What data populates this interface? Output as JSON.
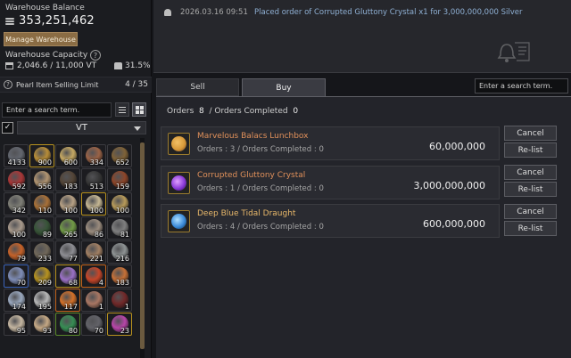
{
  "warehouse": {
    "balance_label": "Warehouse Balance",
    "balance_value": "353,251,462",
    "manage_label": "Manage Warehouse",
    "capacity_label": "Warehouse Capacity",
    "capacity_value": "2,046.6 / 11,000 VT",
    "weight_percent": "31.5%"
  },
  "pearl": {
    "label": "Pearl Item Selling Limit",
    "value": "4 / 35"
  },
  "left_search": {
    "placeholder": "Enter a search term."
  },
  "filter": {
    "checked": "✓",
    "selected": "VT"
  },
  "inventory": [
    {
      "count": "4133",
      "color": "#6b6f78",
      "tier": ""
    },
    {
      "count": "900",
      "color": "#c99a3a",
      "tier": "gold"
    },
    {
      "count": "600",
      "color": "#d8b86a",
      "tier": ""
    },
    {
      "count": "334",
      "color": "#a86a4a",
      "tier": ""
    },
    {
      "count": "652",
      "color": "#8a6a3a",
      "tier": ""
    },
    {
      "count": "592",
      "color": "#b83a3a",
      "tier": ""
    },
    {
      "count": "556",
      "color": "#c2a27a",
      "tier": ""
    },
    {
      "count": "183",
      "color": "#5a4a3a",
      "tier": ""
    },
    {
      "count": "513",
      "color": "#3a3a3a",
      "tier": ""
    },
    {
      "count": "159",
      "color": "#9a4a2a",
      "tier": ""
    },
    {
      "count": "342",
      "color": "#8a8a80",
      "tier": ""
    },
    {
      "count": "110",
      "color": "#b87a3a",
      "tier": ""
    },
    {
      "count": "100",
      "color": "#c8b090",
      "tier": ""
    },
    {
      "count": "100",
      "color": "#d8c8a0",
      "tier": "gold"
    },
    {
      "count": "100",
      "color": "#c8a860",
      "tier": ""
    },
    {
      "count": "100",
      "color": "#b8a898",
      "tier": ""
    },
    {
      "count": "89",
      "color": "#3a5a3a",
      "tier": ""
    },
    {
      "count": "265",
      "color": "#7aa84a",
      "tier": ""
    },
    {
      "count": "86",
      "color": "#a89888",
      "tier": ""
    },
    {
      "count": "81",
      "color": "#8a8a8a",
      "tier": ""
    },
    {
      "count": "79",
      "color": "#d86a2a",
      "tier": ""
    },
    {
      "count": "233",
      "color": "#7a7060",
      "tier": ""
    },
    {
      "count": "77",
      "color": "#9a9aa0",
      "tier": ""
    },
    {
      "count": "221",
      "color": "#b08a6a",
      "tier": ""
    },
    {
      "count": "216",
      "color": "#9aa0a0",
      "tier": ""
    },
    {
      "count": "70",
      "color": "#8a9ac8",
      "tier": "blue"
    },
    {
      "count": "209",
      "color": "#c8a020",
      "tier": ""
    },
    {
      "count": "68",
      "color": "#a87ad8",
      "tier": "gold"
    },
    {
      "count": "4",
      "color": "#d84a2a",
      "tier": "orange"
    },
    {
      "count": "183",
      "color": "#d87a3a",
      "tier": ""
    },
    {
      "count": "174",
      "color": "#a8b8d0",
      "tier": ""
    },
    {
      "count": "195",
      "color": "#c8c8c8",
      "tier": ""
    },
    {
      "count": "117",
      "color": "#e87a2a",
      "tier": "orange"
    },
    {
      "count": "1",
      "color": "#b8806a",
      "tier": ""
    },
    {
      "count": "1",
      "color": "#7a2a2a",
      "tier": ""
    },
    {
      "count": "95",
      "color": "#d8c8b0",
      "tier": ""
    },
    {
      "count": "93",
      "color": "#d8b890",
      "tier": ""
    },
    {
      "count": "80",
      "color": "#3a9a5a",
      "tier": "green"
    },
    {
      "count": "70",
      "color": "#6a6a70",
      "tier": ""
    },
    {
      "count": "23",
      "color": "#c84ab8",
      "tier": "gold"
    }
  ],
  "notification": {
    "time": "2026.03.16 09:51",
    "message": "Placed order of Corrupted Gluttony Crystal x1 for 3,000,000,000 Silver"
  },
  "tabs": {
    "sell": "Sell",
    "buy": "Buy"
  },
  "right_search": {
    "placeholder": "Enter a search term."
  },
  "summary": {
    "orders_label": "Orders",
    "orders_count": "8",
    "completed_label": "/ Orders Completed",
    "completed_count": "0"
  },
  "orders": [
    {
      "name": "Marvelous Balacs Lunchbox",
      "name_color": "#e0905a",
      "detail": "Orders : 3 / Orders Completed : 0",
      "price": "60,000,000",
      "icon_color": "#d89a3a"
    },
    {
      "name": "Corrupted Gluttony Crystal",
      "name_color": "#e0905a",
      "detail": "Orders : 1 / Orders Completed : 0",
      "price": "3,000,000,000",
      "icon_color": "#8a3ad8"
    },
    {
      "name": "Deep Blue Tidal Draught",
      "name_color": "#e8b86a",
      "detail": "Orders : 4 / Orders Completed : 0",
      "price": "600,000,000",
      "icon_color": "#3a8ad8"
    }
  ],
  "buttons": {
    "cancel": "Cancel",
    "relist": "Re-list"
  }
}
